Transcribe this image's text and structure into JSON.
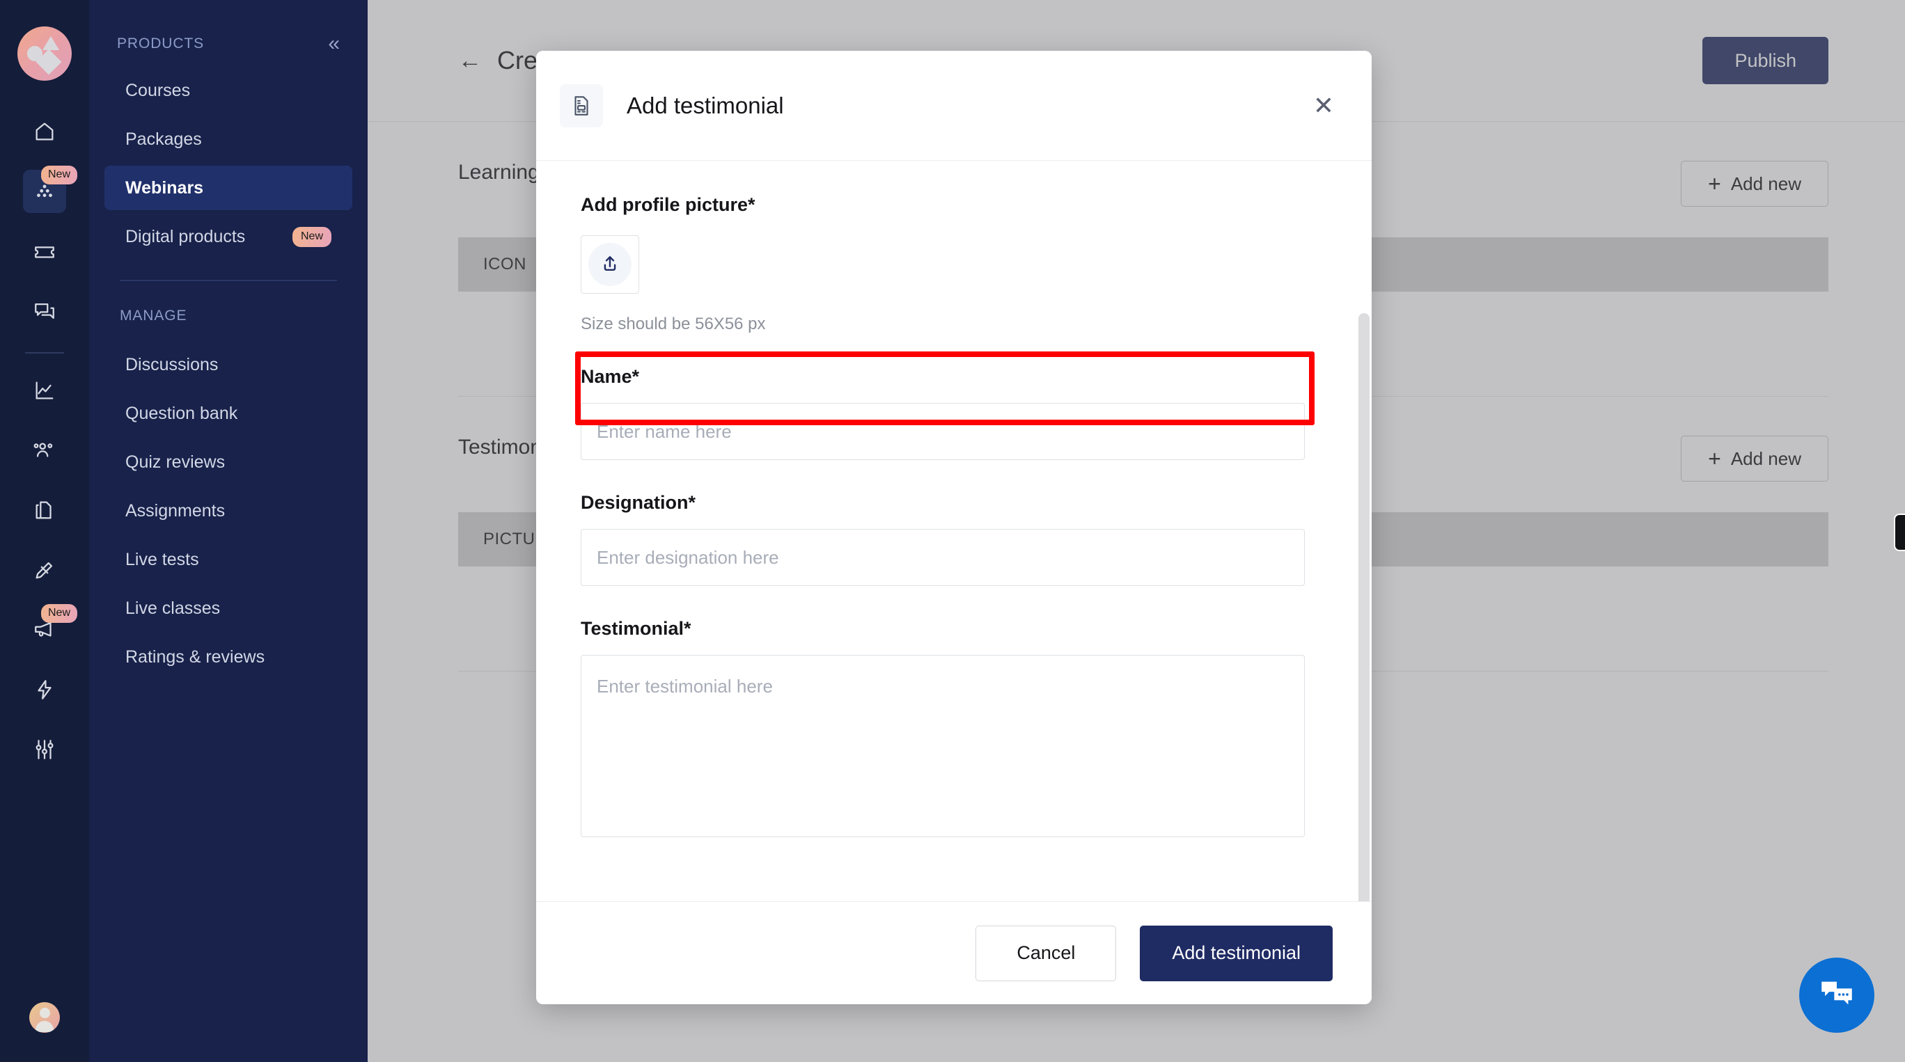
{
  "rail": {
    "logo_name": "brand-logo",
    "items": [
      {
        "name": "home",
        "icon": "home-icon",
        "badge": "",
        "active": false
      },
      {
        "name": "products",
        "icon": "products-icon",
        "badge": "New",
        "active": true
      },
      {
        "name": "orders",
        "icon": "ticket-icon",
        "badge": "",
        "active": false
      },
      {
        "name": "messages",
        "icon": "chat-icon",
        "badge": "",
        "active": false
      },
      {
        "name": "analytics",
        "icon": "chart-line-icon",
        "badge": "",
        "active": false
      },
      {
        "name": "learners",
        "icon": "users-icon",
        "badge": "",
        "active": false
      },
      {
        "name": "pages",
        "icon": "copy-icon",
        "badge": "",
        "active": false
      },
      {
        "name": "design",
        "icon": "pen-ruler-icon",
        "badge": "",
        "active": false
      },
      {
        "name": "marketing",
        "icon": "megaphone-icon",
        "badge": "New",
        "active": false
      },
      {
        "name": "automation",
        "icon": "bolt-icon",
        "badge": "",
        "active": false
      },
      {
        "name": "settings",
        "icon": "sliders-icon",
        "badge": "",
        "active": false
      }
    ]
  },
  "nav": {
    "section_label": "PRODUCTS",
    "collapse_icon": "«",
    "products": [
      {
        "label": "Courses",
        "pill": "",
        "active": false
      },
      {
        "label": "Packages",
        "pill": "",
        "active": false
      },
      {
        "label": "Webinars",
        "pill": "",
        "active": true
      },
      {
        "label": "Digital products",
        "pill": "New",
        "active": false
      }
    ],
    "manage_label": "MANAGE",
    "manage": [
      {
        "label": "Discussions",
        "pill": "",
        "active": false
      },
      {
        "label": "Question bank",
        "pill": "",
        "active": false
      },
      {
        "label": "Quiz reviews",
        "pill": "",
        "active": false
      },
      {
        "label": "Assignments",
        "pill": "",
        "active": false
      },
      {
        "label": "Live tests",
        "pill": "",
        "active": false
      },
      {
        "label": "Live classes",
        "pill": "",
        "active": false
      },
      {
        "label": "Ratings & reviews",
        "pill": "",
        "active": false
      }
    ]
  },
  "page": {
    "back_icon": "←",
    "title": "Create webinar",
    "publish_label": "Publish",
    "sections": [
      {
        "title": "Learning outcomes",
        "action_label": "Add new",
        "action_plus": "+",
        "placeholder_label": "ICON"
      },
      {
        "title": "Testimonials",
        "action_label": "Add new",
        "action_plus": "+",
        "placeholder_label": "PICTURE"
      }
    ]
  },
  "modal": {
    "icon": "document-icon",
    "title": "Add testimonial",
    "close_icon": "✕",
    "profile_picture": {
      "label": "Add profile picture*",
      "upload_icon": "upload-icon",
      "hint": "Size should be 56X56 px"
    },
    "fields": [
      {
        "label": "Name*",
        "placeholder": "Enter name here",
        "value": "",
        "highlighted": true
      },
      {
        "label": "Designation*",
        "placeholder": "Enter designation here",
        "value": "",
        "highlighted": false
      },
      {
        "label": "Testimonial*",
        "placeholder": "Enter testimonial here",
        "value": "",
        "highlighted": false
      }
    ],
    "footer": {
      "cancel_label": "Cancel",
      "submit_label": "Add testimonial"
    }
  },
  "widgets": {
    "chat_icon": "chat-bubbles-icon",
    "edge_tab": "edge-tab"
  },
  "colors": {
    "rail_bg": "#141d3a",
    "nav_bg": "#18224a",
    "nav_active": "#20306a",
    "primary": "#1f2b63",
    "highlight": "#fe0000",
    "chat_blue": "#0b6fd4",
    "badge_gradient_start": "#f2b48e",
    "badge_gradient_end": "#e7a4bb"
  }
}
